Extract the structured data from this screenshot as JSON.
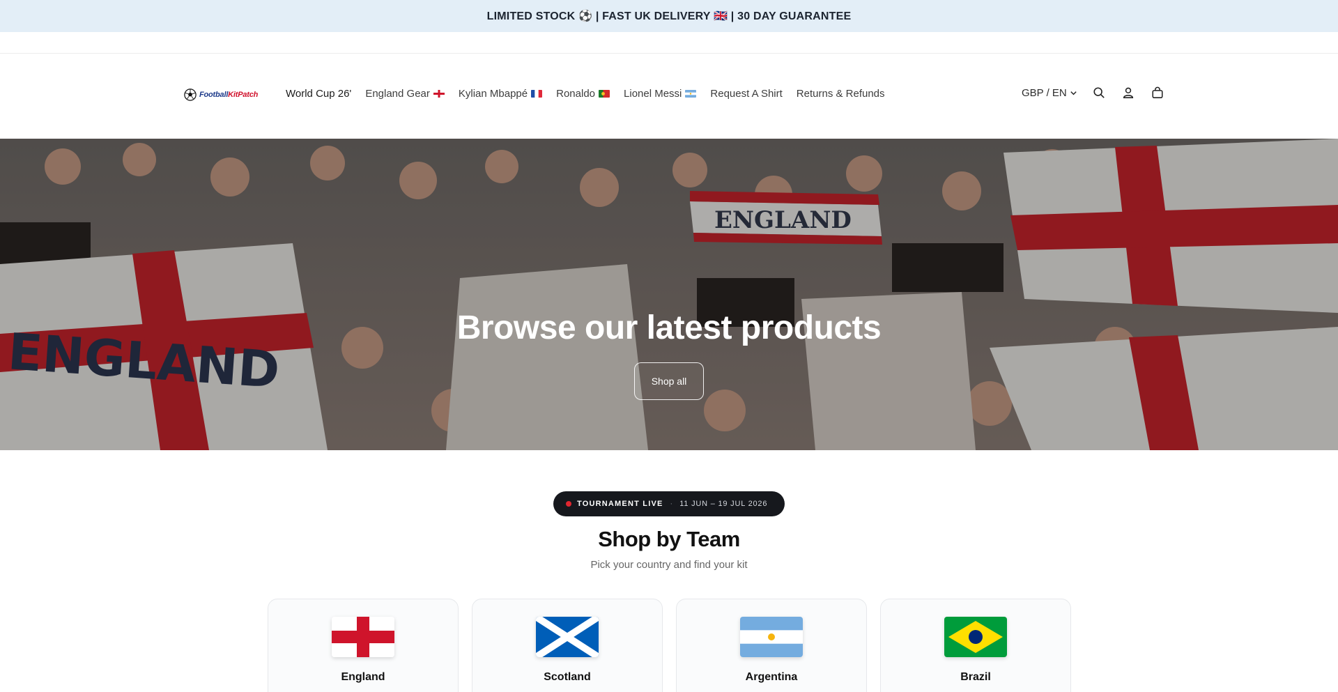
{
  "announcement": {
    "text": "LIMITED STOCK ⚽️ | FAST UK DELIVERY 🇬🇧 | 30 DAY GUARANTEE"
  },
  "header": {
    "logo": {
      "part1": "Football",
      "part2": "KitPatch"
    },
    "nav": [
      {
        "label": "World Cup 26'",
        "flag": ""
      },
      {
        "label": "England Gear",
        "flag": "england"
      },
      {
        "label": "Kylian Mbappé",
        "flag": "france"
      },
      {
        "label": "Ronaldo",
        "flag": "portugal"
      },
      {
        "label": "Lionel Messi",
        "flag": "argentina"
      },
      {
        "label": "Request A Shirt",
        "flag": ""
      },
      {
        "label": "Returns & Refunds",
        "flag": ""
      }
    ],
    "locale": "GBP / EN",
    "icons": [
      "search-icon",
      "account-icon",
      "cart-icon"
    ]
  },
  "hero": {
    "title": "Browse our latest products",
    "button": "Shop all"
  },
  "tournament": {
    "status": "TOURNAMENT LIVE",
    "separator": "·",
    "dates": "11 JUN – 19 JUL 2026"
  },
  "teams_section": {
    "title": "Shop by Team",
    "subtitle": "Pick your country and find your kit",
    "teams": [
      {
        "name": "England"
      },
      {
        "name": "Scotland"
      },
      {
        "name": "Argentina"
      },
      {
        "name": "Brazil"
      }
    ]
  },
  "colors": {
    "announcement_bg": "#e3eef7",
    "england_red": "#cf142b",
    "scotland_blue": "#005eb8",
    "argentina_blue": "#74acdf",
    "brazil_green": "#009c3b",
    "brazil_yellow": "#ffdf00",
    "brazil_blue": "#002776",
    "live_dot": "#e0262f"
  }
}
